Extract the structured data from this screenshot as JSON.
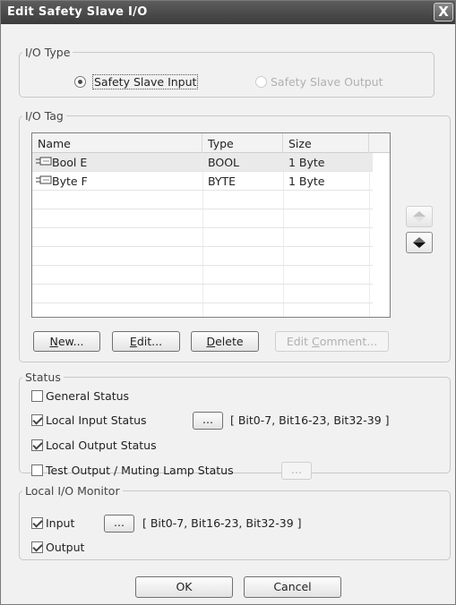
{
  "window": {
    "title": "Edit Safety Slave I/O",
    "close_symbol": "X"
  },
  "io_type": {
    "legend": "I/O Type",
    "options": [
      {
        "label": "Safety Slave Input",
        "checked": true,
        "enabled": true
      },
      {
        "label": "Safety Slave Output",
        "checked": false,
        "enabled": false
      }
    ]
  },
  "io_tag": {
    "legend": "I/O Tag",
    "columns": [
      "Name",
      "Type",
      "Size"
    ],
    "rows": [
      {
        "name": "Bool E",
        "type": "BOOL",
        "size": "1 Byte"
      },
      {
        "name": "Byte F",
        "type": "BYTE",
        "size": "1 Byte"
      }
    ],
    "buttons": {
      "new": {
        "label": "New...",
        "mnemonic": "N"
      },
      "edit": {
        "label": "Edit...",
        "mnemonic": "E"
      },
      "delete": {
        "label": "Delete",
        "mnemonic": "D"
      },
      "edit_comment": {
        "label": "Edit Comment...",
        "mnemonic": "C"
      }
    }
  },
  "status": {
    "legend": "Status",
    "items": [
      {
        "label": "General Status",
        "checked": false
      },
      {
        "label": "Local Input Status",
        "checked": true,
        "button": "...",
        "info": "[ Bit0-7, Bit16-23, Bit32-39 ]"
      },
      {
        "label": "Local Output Status",
        "checked": true
      },
      {
        "label": "Test Output / Muting Lamp Status",
        "checked": false,
        "button": "..."
      }
    ]
  },
  "monitor": {
    "legend": "Local I/O Monitor",
    "items": [
      {
        "label": "Input",
        "checked": true,
        "button": "...",
        "info": "[ Bit0-7, Bit16-23, Bit32-39 ]"
      },
      {
        "label": "Output",
        "checked": true
      }
    ]
  },
  "footer": {
    "ok": "OK",
    "cancel": "Cancel"
  }
}
